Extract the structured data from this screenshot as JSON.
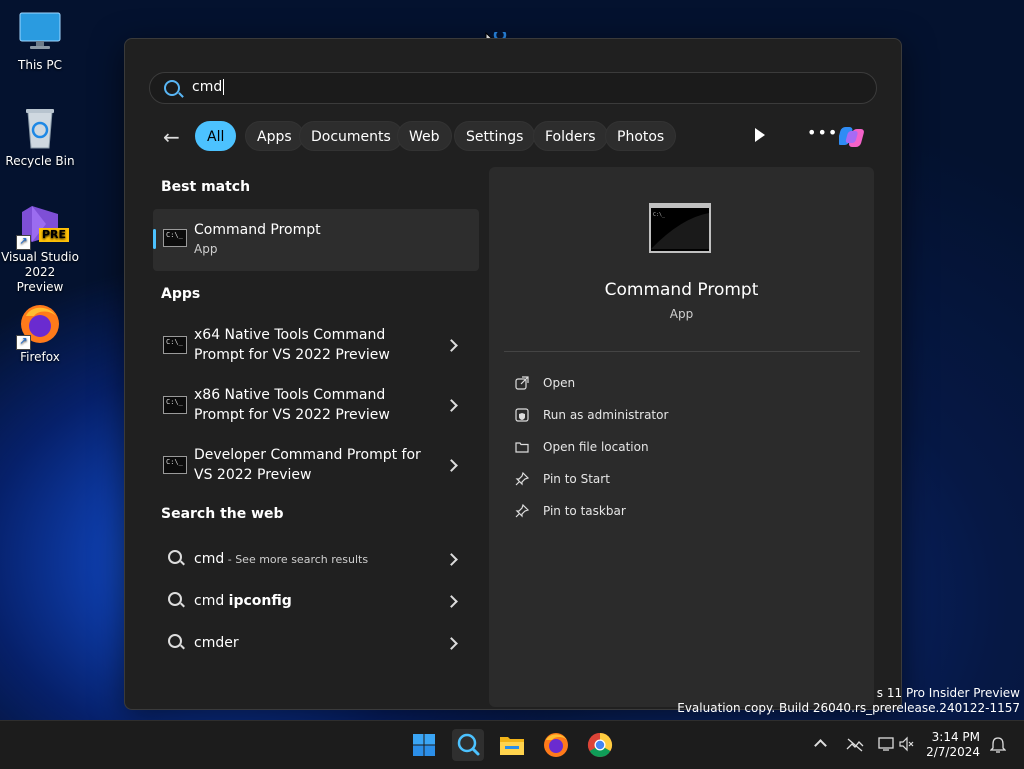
{
  "desktop": {
    "icons": [
      {
        "label": "This PC"
      },
      {
        "label": "Recycle Bin"
      },
      {
        "label": "Visual Studio 2022 Preview",
        "badge": "PRE"
      },
      {
        "label": "Firefox"
      }
    ],
    "watermark": {
      "line1": "s 11 Pro Insider Preview",
      "line2": "Evaluation copy. Build 26040.rs_prerelease.240122-1157"
    }
  },
  "search": {
    "query": "cmd",
    "filters": [
      "All",
      "Apps",
      "Documents",
      "Web",
      "Settings",
      "Folders",
      "Photos"
    ],
    "active_filter": "All"
  },
  "results": {
    "best_match_heading": "Best match",
    "best_match": {
      "title": "Command Prompt",
      "subtitle": "App"
    },
    "apps_heading": "Apps",
    "apps": [
      {
        "line1": "x64 Native Tools Command",
        "line2": "Prompt for VS 2022 Preview"
      },
      {
        "line1": "x86 Native Tools Command",
        "line2": "Prompt for VS 2022 Preview"
      },
      {
        "line1": "Developer Command Prompt for",
        "line2": "VS 2022 Preview"
      }
    ],
    "web_heading": "Search the web",
    "web": [
      {
        "term": "cmd",
        "suffix": " - See more search results"
      },
      {
        "term": "cmd ",
        "bold": "ipconfig"
      },
      {
        "term": "cmder"
      }
    ]
  },
  "detail": {
    "title": "Command Prompt",
    "subtitle": "App",
    "actions": [
      "Open",
      "Run as administrator",
      "Open file location",
      "Pin to Start",
      "Pin to taskbar"
    ]
  },
  "taskbar": {
    "time": "3:14 PM",
    "date": "2/7/2024",
    "apps": [
      "start-icon",
      "search-icon",
      "file-explorer-icon",
      "firefox-icon",
      "chrome-icon"
    ]
  },
  "colors": {
    "accent": "#4cc2ff",
    "panel": "#202020",
    "pane": "#2b2b2b"
  }
}
